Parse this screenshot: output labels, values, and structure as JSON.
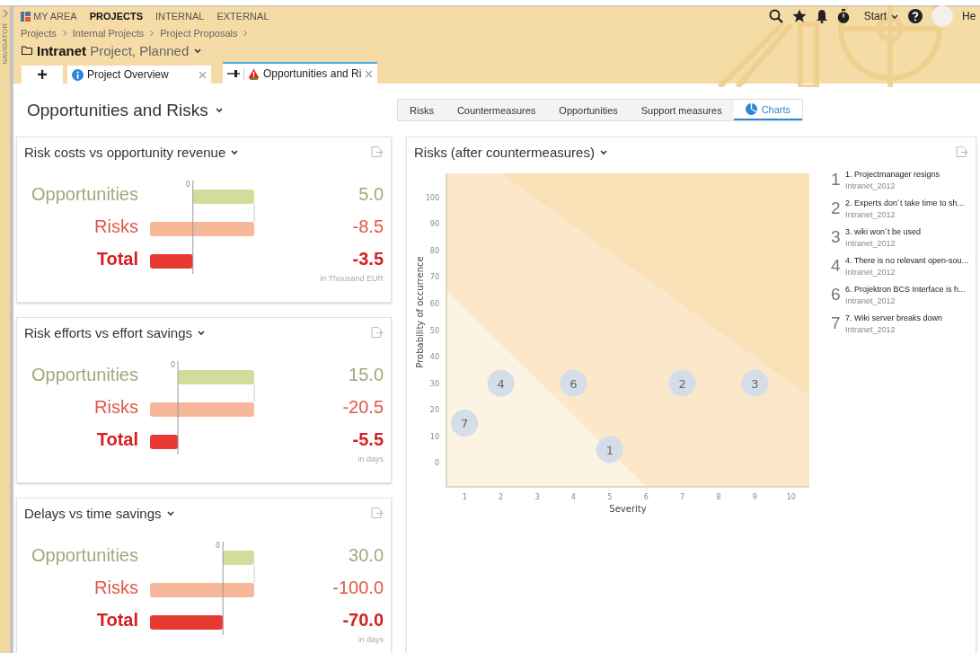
{
  "navigator": {
    "label": "NAVIGATOR"
  },
  "top_nav": [
    {
      "label": "MY AREA",
      "kind": "home",
      "selected": false
    },
    {
      "label": "PROJECTS",
      "kind": "plain",
      "selected": true
    },
    {
      "label": "INTERNAL",
      "kind": "plain",
      "selected": false
    },
    {
      "label": "EXTERNAL",
      "kind": "plain",
      "selected": false
    }
  ],
  "toolbar": {
    "start": "Start",
    "user": "He"
  },
  "breadcrumbs": [
    "Projects",
    "Internal Projects",
    "Project Proposals"
  ],
  "project": {
    "name": "Intranet",
    "status": "Project, Planned"
  },
  "doc_tabs": [
    {
      "kind": "add",
      "label": "+",
      "selected": false
    },
    {
      "kind": "info",
      "label": "Project Overview",
      "selected": false
    },
    {
      "kind": "warning",
      "label": "Opportunities and Ri",
      "selected": true
    }
  ],
  "page_title": "Opportunities and Risks",
  "view_tabs": [
    {
      "label": "Risks",
      "selected": false
    },
    {
      "label": "Countermeasures",
      "selected": false
    },
    {
      "label": "Opportunities",
      "selected": false
    },
    {
      "label": "Support measures",
      "selected": false
    },
    {
      "label": "Charts",
      "selected": true
    }
  ],
  "panels": [
    {
      "title": "Risk costs vs opportunity revenue",
      "unit": "in Thousand EUR",
      "zero_tick": "0",
      "rows": [
        {
          "kind": "step",
          "label": "Opportunities",
          "value": "5.0"
        },
        {
          "kind": "step",
          "label": "Risks",
          "value": "-8.5"
        },
        {
          "kind": "total",
          "label": "Total",
          "value": "-3.5"
        }
      ]
    },
    {
      "title": "Risk efforts vs effort savings",
      "unit": "in days",
      "zero_tick": "0",
      "rows": [
        {
          "kind": "step",
          "label": "Opportunities",
          "value": "15.0"
        },
        {
          "kind": "step",
          "label": "Risks",
          "value": "-20.5"
        },
        {
          "kind": "total",
          "label": "Total",
          "value": "-5.5"
        }
      ]
    },
    {
      "title": "Delays vs time savings",
      "unit": "in days",
      "zero_tick": "0",
      "rows": [
        {
          "kind": "step",
          "label": "Opportunities",
          "value": "30.0"
        },
        {
          "kind": "step",
          "label": "Risks",
          "value": "-100.0"
        },
        {
          "kind": "total",
          "label": "Total",
          "value": "-70.0"
        }
      ]
    }
  ],
  "risk_chart": {
    "title": "Risks (after countermeasures)",
    "chart_data": {
      "type": "scatter",
      "xlabel": "Severity",
      "ylabel": "Probability of occurrence",
      "x": [
        5,
        7,
        9,
        2,
        4,
        1
      ],
      "series": [
        {
          "color": "#d5dde9",
          "values": [
            5,
            30,
            30,
            30,
            30,
            15
          ]
        }
      ],
      "value_labels": [
        "1",
        "2",
        "3",
        "4",
        "6",
        "7"
      ],
      "xlim": [
        0.5,
        10.5
      ],
      "ylim": [
        -9,
        109
      ],
      "xticks": [
        1,
        2,
        3,
        4,
        5,
        6,
        7,
        8,
        9,
        10
      ],
      "yticks": [
        0,
        10,
        20,
        30,
        40,
        50,
        60,
        70,
        80,
        90,
        100
      ]
    }
  },
  "legend": [
    {
      "number": "1",
      "title": "1. Projectmanager resigns",
      "project": "Intranet_2012"
    },
    {
      "number": "2",
      "title": "2. Experts don´t take time to sh...",
      "project": "Intranet_2012"
    },
    {
      "number": "3",
      "title": "3. wiki won´t be used",
      "project": "Intranet_2012"
    },
    {
      "number": "4",
      "title": "4. There is no relevant open-sou...",
      "project": "Intranet_2012"
    },
    {
      "number": "6",
      "title": "6. Projektron BCS Interface is h...",
      "project": "Intranet_2012"
    },
    {
      "number": "7",
      "title": "7. Wiki server breaks down",
      "project": "Intranet_2012"
    }
  ]
}
